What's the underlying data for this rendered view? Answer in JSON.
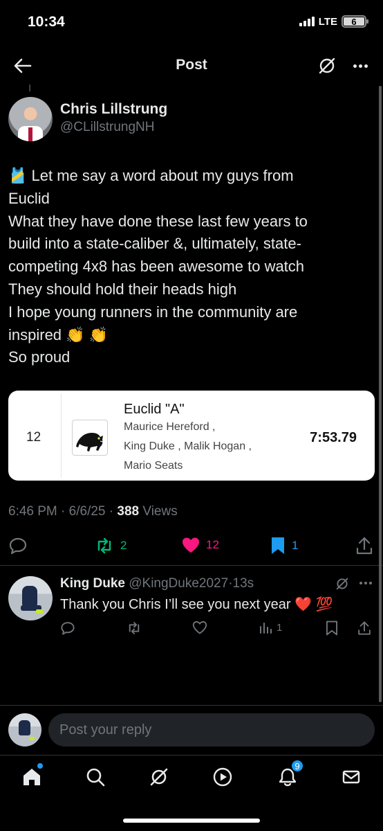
{
  "status": {
    "time": "10:34",
    "network": "LTE",
    "battery": "6"
  },
  "nav": {
    "title": "Post"
  },
  "post": {
    "author_name": "Chris Lillstrung",
    "author_handle": "@CLillstrungNH",
    "lines": [
      "🎽 Let me say a word about my guys from",
      "Euclid",
      "What they have done these last few years to",
      "build into a state-caliber &, ultimately, state-",
      "competing 4x8 has been awesome to watch",
      "They should hold their heads high",
      "I hope young runners in the community are",
      "inspired 👏 👏",
      "So proud"
    ],
    "time": "6:46 PM",
    "dot": "·",
    "date": "6/6/25",
    "views_count": "388",
    "views_label": "Views"
  },
  "result_card": {
    "place": "12",
    "team": "Euclid \"A\"",
    "athletes": [
      "Maurice Hereford ,",
      "King Duke , Malik Hogan ,",
      "Mario Seats"
    ],
    "time": "7:53.79"
  },
  "actions": {
    "retweets": "2",
    "likes": "12",
    "bookmarks": "1"
  },
  "reply": {
    "name": "King Duke",
    "handle": "@KingDuke2027",
    "dot": "·",
    "age": "13s",
    "text": "Thank you Chris I’ll see you next year ❤️ 💯",
    "views": "1"
  },
  "composer": {
    "placeholder": "Post your reply"
  },
  "bottom_nav": {
    "notifications_badge": "9"
  },
  "colors": {
    "like": "#f91880",
    "retweet": "#00ba7c",
    "bookmark": "#1d9bf0",
    "muted": "#71767b"
  }
}
